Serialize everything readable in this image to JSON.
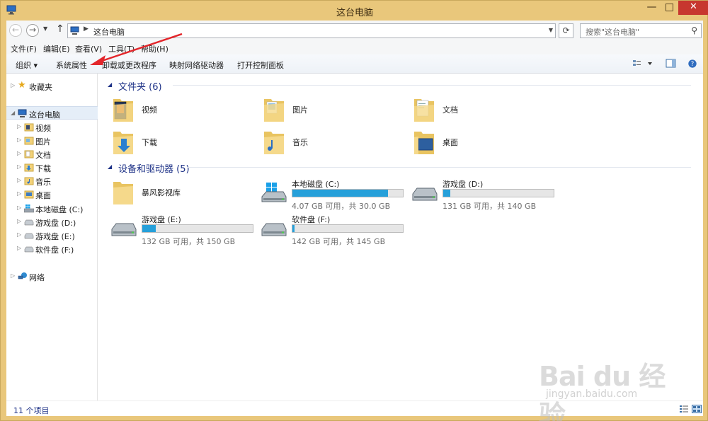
{
  "window": {
    "title": "这台电脑",
    "minimize_glyph": "—",
    "maximize_glyph": "□",
    "close_glyph": "✕"
  },
  "address": {
    "path": "这台电脑",
    "search_placeholder": "搜索\"这台电脑\""
  },
  "menu": [
    "文件(F)",
    "编辑(E)",
    "查看(V)",
    "工具(T)",
    "帮助(H)"
  ],
  "commands": {
    "organize": "组织 ▾",
    "system_properties": "系统属性",
    "uninstall": "卸载或更改程序",
    "map_drive": "映射网络驱动器",
    "control_panel": "打开控制面板"
  },
  "nav": {
    "favorites": "收藏夹",
    "this_pc": "这台电脑",
    "children": [
      "视频",
      "图片",
      "文档",
      "下载",
      "音乐",
      "桌面",
      "本地磁盘 (C:)",
      "游戏盘 (D:)",
      "游戏盘 (E:)",
      "软件盘 (F:)"
    ],
    "network": "网络"
  },
  "folders_group": "文件夹 (6)",
  "folders": [
    "视频",
    "图片",
    "文档",
    "下载",
    "音乐",
    "桌面"
  ],
  "devices_group": "设备和驱动器 (5)",
  "library": "暴风影视库",
  "drives": [
    {
      "name": "本地磁盘 (C:)",
      "free": "4.07 GB 可用，共 30.0 GB",
      "used_fraction": 0.864
    },
    {
      "name": "游戏盘 (D:)",
      "free": "131 GB 可用，共 140 GB",
      "used_fraction": 0.064
    },
    {
      "name": "游戏盘 (E:)",
      "free": "132 GB 可用，共 150 GB",
      "used_fraction": 0.12
    },
    {
      "name": "软件盘 (F:)",
      "free": "142 GB 可用，共 145 GB",
      "used_fraction": 0.021
    }
  ],
  "status": {
    "count": "11 个项目"
  },
  "watermark": {
    "main": "Bai du 经验",
    "sub": "jingyan.baidu.com"
  },
  "colors": {
    "accent": "#1e3287",
    "drive_fill": "#26a0da",
    "close_red": "#c7372f",
    "frame": "#e9c77b",
    "annotation": "#e3262b"
  }
}
